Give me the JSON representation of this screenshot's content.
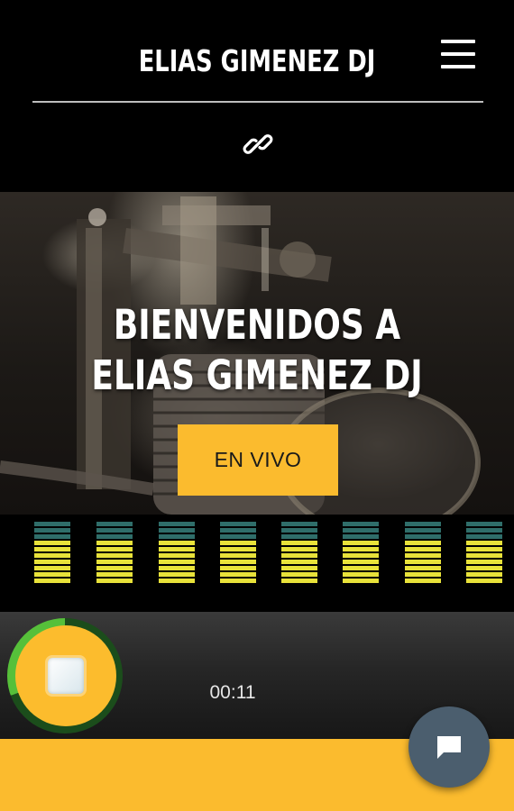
{
  "header": {
    "title": "ELIAS GIMENEZ DJ",
    "menu_icon": "hamburger-menu-icon",
    "link_icon": "link-icon"
  },
  "hero": {
    "title_line1": "BIENVENIDOS A",
    "title_line2": "ELIAS GIMENEZ DJ",
    "button_label": "EN VIVO"
  },
  "player": {
    "elapsed": "00:11",
    "play_state_icon": "stop-icon"
  },
  "chat": {
    "icon": "chat-bubble-icon"
  },
  "colors": {
    "accent_yellow": "#fbbb2e",
    "eq_teal": "#2f6e6a",
    "eq_yellow": "#e8e23a",
    "ring_green": "#56c03a",
    "chat_button": "#4b5e6e"
  }
}
